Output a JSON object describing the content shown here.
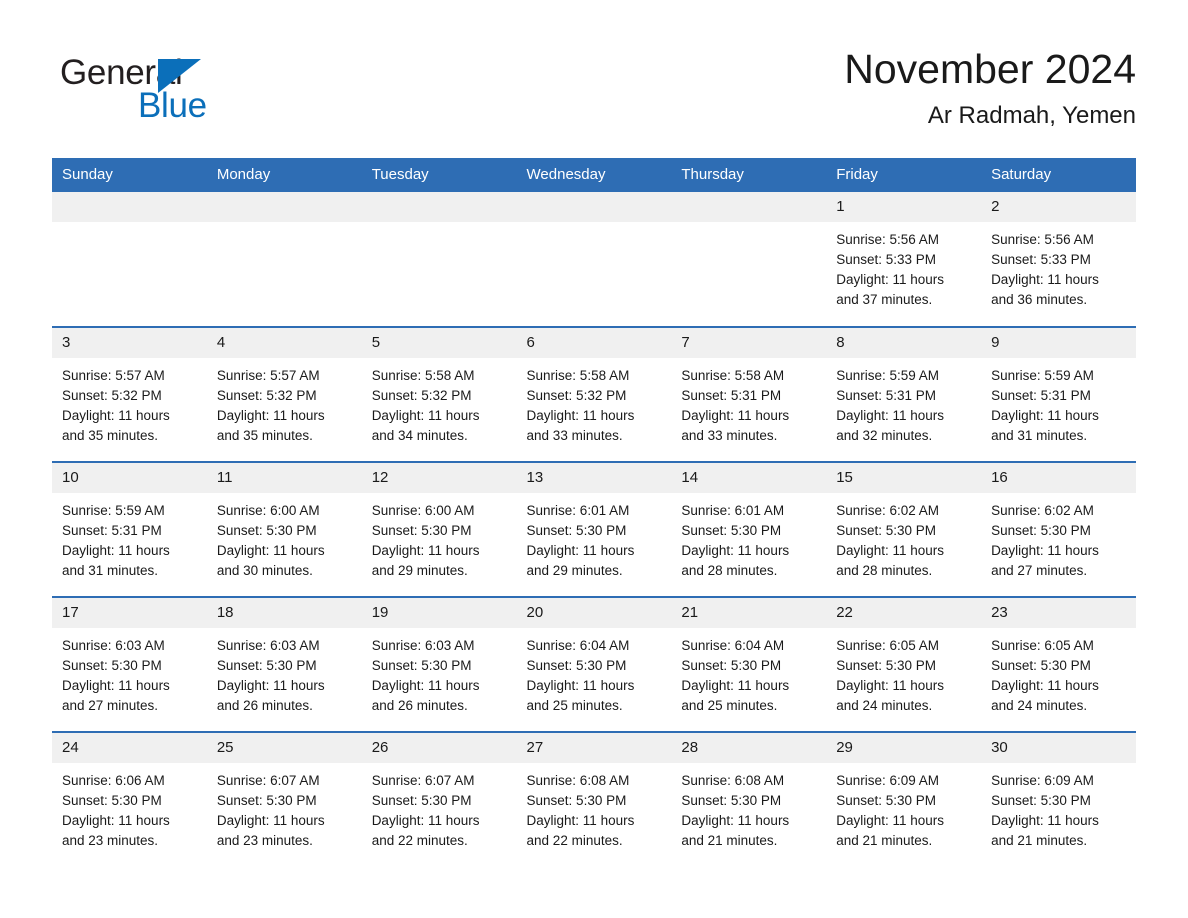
{
  "brand": {
    "name_part1": "General",
    "name_part2": "Blue",
    "triangle_color": "#0b6fba"
  },
  "header": {
    "month_title": "November 2024",
    "location": "Ar Radmah, Yemen"
  },
  "theme": {
    "header_blue": "#2e6db4",
    "daynum_band": "#f0f0f0",
    "text": "#1a1a1a",
    "page_bg": "#ffffff"
  },
  "weekday_headers": [
    "Sunday",
    "Monday",
    "Tuesday",
    "Wednesday",
    "Thursday",
    "Friday",
    "Saturday"
  ],
  "weeks": [
    [
      {
        "day": "",
        "lines": []
      },
      {
        "day": "",
        "lines": []
      },
      {
        "day": "",
        "lines": []
      },
      {
        "day": "",
        "lines": []
      },
      {
        "day": "",
        "lines": []
      },
      {
        "day": "1",
        "lines": [
          "Sunrise: 5:56 AM",
          "Sunset: 5:33 PM",
          "Daylight: 11 hours",
          "and 37 minutes."
        ]
      },
      {
        "day": "2",
        "lines": [
          "Sunrise: 5:56 AM",
          "Sunset: 5:33 PM",
          "Daylight: 11 hours",
          "and 36 minutes."
        ]
      }
    ],
    [
      {
        "day": "3",
        "lines": [
          "Sunrise: 5:57 AM",
          "Sunset: 5:32 PM",
          "Daylight: 11 hours",
          "and 35 minutes."
        ]
      },
      {
        "day": "4",
        "lines": [
          "Sunrise: 5:57 AM",
          "Sunset: 5:32 PM",
          "Daylight: 11 hours",
          "and 35 minutes."
        ]
      },
      {
        "day": "5",
        "lines": [
          "Sunrise: 5:58 AM",
          "Sunset: 5:32 PM",
          "Daylight: 11 hours",
          "and 34 minutes."
        ]
      },
      {
        "day": "6",
        "lines": [
          "Sunrise: 5:58 AM",
          "Sunset: 5:32 PM",
          "Daylight: 11 hours",
          "and 33 minutes."
        ]
      },
      {
        "day": "7",
        "lines": [
          "Sunrise: 5:58 AM",
          "Sunset: 5:31 PM",
          "Daylight: 11 hours",
          "and 33 minutes."
        ]
      },
      {
        "day": "8",
        "lines": [
          "Sunrise: 5:59 AM",
          "Sunset: 5:31 PM",
          "Daylight: 11 hours",
          "and 32 minutes."
        ]
      },
      {
        "day": "9",
        "lines": [
          "Sunrise: 5:59 AM",
          "Sunset: 5:31 PM",
          "Daylight: 11 hours",
          "and 31 minutes."
        ]
      }
    ],
    [
      {
        "day": "10",
        "lines": [
          "Sunrise: 5:59 AM",
          "Sunset: 5:31 PM",
          "Daylight: 11 hours",
          "and 31 minutes."
        ]
      },
      {
        "day": "11",
        "lines": [
          "Sunrise: 6:00 AM",
          "Sunset: 5:30 PM",
          "Daylight: 11 hours",
          "and 30 minutes."
        ]
      },
      {
        "day": "12",
        "lines": [
          "Sunrise: 6:00 AM",
          "Sunset: 5:30 PM",
          "Daylight: 11 hours",
          "and 29 minutes."
        ]
      },
      {
        "day": "13",
        "lines": [
          "Sunrise: 6:01 AM",
          "Sunset: 5:30 PM",
          "Daylight: 11 hours",
          "and 29 minutes."
        ]
      },
      {
        "day": "14",
        "lines": [
          "Sunrise: 6:01 AM",
          "Sunset: 5:30 PM",
          "Daylight: 11 hours",
          "and 28 minutes."
        ]
      },
      {
        "day": "15",
        "lines": [
          "Sunrise: 6:02 AM",
          "Sunset: 5:30 PM",
          "Daylight: 11 hours",
          "and 28 minutes."
        ]
      },
      {
        "day": "16",
        "lines": [
          "Sunrise: 6:02 AM",
          "Sunset: 5:30 PM",
          "Daylight: 11 hours",
          "and 27 minutes."
        ]
      }
    ],
    [
      {
        "day": "17",
        "lines": [
          "Sunrise: 6:03 AM",
          "Sunset: 5:30 PM",
          "Daylight: 11 hours",
          "and 27 minutes."
        ]
      },
      {
        "day": "18",
        "lines": [
          "Sunrise: 6:03 AM",
          "Sunset: 5:30 PM",
          "Daylight: 11 hours",
          "and 26 minutes."
        ]
      },
      {
        "day": "19",
        "lines": [
          "Sunrise: 6:03 AM",
          "Sunset: 5:30 PM",
          "Daylight: 11 hours",
          "and 26 minutes."
        ]
      },
      {
        "day": "20",
        "lines": [
          "Sunrise: 6:04 AM",
          "Sunset: 5:30 PM",
          "Daylight: 11 hours",
          "and 25 minutes."
        ]
      },
      {
        "day": "21",
        "lines": [
          "Sunrise: 6:04 AM",
          "Sunset: 5:30 PM",
          "Daylight: 11 hours",
          "and 25 minutes."
        ]
      },
      {
        "day": "22",
        "lines": [
          "Sunrise: 6:05 AM",
          "Sunset: 5:30 PM",
          "Daylight: 11 hours",
          "and 24 minutes."
        ]
      },
      {
        "day": "23",
        "lines": [
          "Sunrise: 6:05 AM",
          "Sunset: 5:30 PM",
          "Daylight: 11 hours",
          "and 24 minutes."
        ]
      }
    ],
    [
      {
        "day": "24",
        "lines": [
          "Sunrise: 6:06 AM",
          "Sunset: 5:30 PM",
          "Daylight: 11 hours",
          "and 23 minutes."
        ]
      },
      {
        "day": "25",
        "lines": [
          "Sunrise: 6:07 AM",
          "Sunset: 5:30 PM",
          "Daylight: 11 hours",
          "and 23 minutes."
        ]
      },
      {
        "day": "26",
        "lines": [
          "Sunrise: 6:07 AM",
          "Sunset: 5:30 PM",
          "Daylight: 11 hours",
          "and 22 minutes."
        ]
      },
      {
        "day": "27",
        "lines": [
          "Sunrise: 6:08 AM",
          "Sunset: 5:30 PM",
          "Daylight: 11 hours",
          "and 22 minutes."
        ]
      },
      {
        "day": "28",
        "lines": [
          "Sunrise: 6:08 AM",
          "Sunset: 5:30 PM",
          "Daylight: 11 hours",
          "and 21 minutes."
        ]
      },
      {
        "day": "29",
        "lines": [
          "Sunrise: 6:09 AM",
          "Sunset: 5:30 PM",
          "Daylight: 11 hours",
          "and 21 minutes."
        ]
      },
      {
        "day": "30",
        "lines": [
          "Sunrise: 6:09 AM",
          "Sunset: 5:30 PM",
          "Daylight: 11 hours",
          "and 21 minutes."
        ]
      }
    ]
  ]
}
